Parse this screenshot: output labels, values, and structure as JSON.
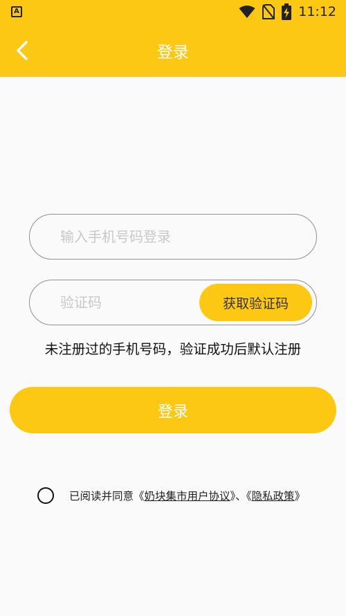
{
  "status_bar": {
    "app_icon_letter": "A",
    "time": "11:12",
    "icons": [
      "wifi-icon",
      "no-sim-icon",
      "battery-charging-icon"
    ]
  },
  "header": {
    "title": "登录",
    "back_icon": "chevron-left-icon"
  },
  "phone_input": {
    "placeholder": "输入手机号码登录",
    "value": ""
  },
  "code_input": {
    "placeholder": "验证码",
    "value": ""
  },
  "get_code_label": "获取验证码",
  "hint": "未注册过的手机号码，验证成功后默认注册",
  "login_label": "登录",
  "agreement": {
    "prefix": "已阅读并同意《",
    "user_agreement": "奶块集市用户协议",
    "separator": "》、《",
    "privacy_policy": "隐私政策",
    "suffix": "》",
    "checked": false
  },
  "colors": {
    "accent": "#fdc814",
    "background": "#fafafa",
    "border": "#8f8f8f"
  }
}
